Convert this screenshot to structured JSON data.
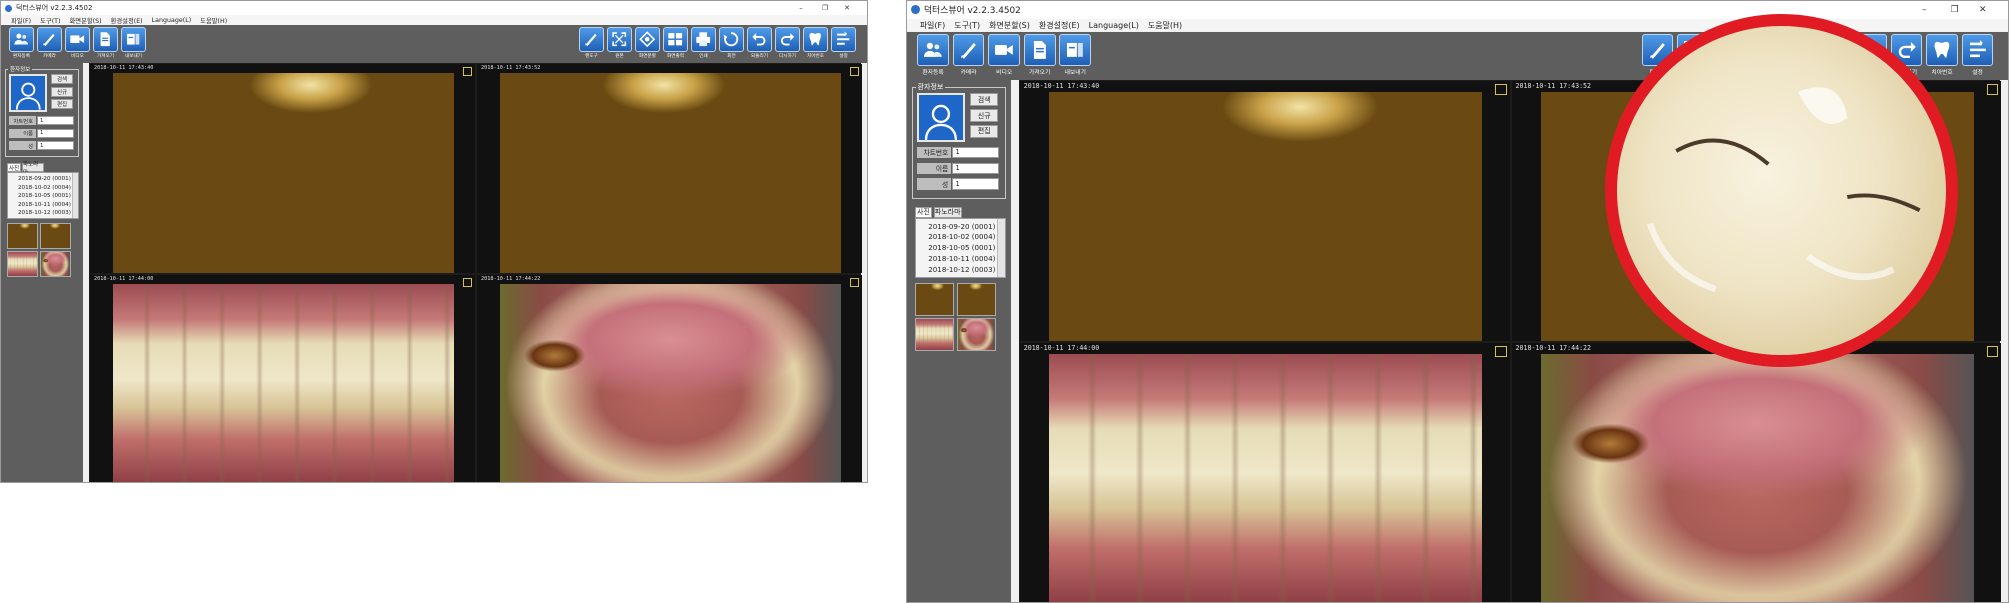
{
  "app": {
    "title": "덕터스뷰어 v2.2.3.4502",
    "menus": [
      "파일(F)",
      "도구(T)",
      "화면분할(S)",
      "환경설정(E)",
      "Language(L)",
      "도움말(H)"
    ]
  },
  "window_controls": {
    "minimize": "–",
    "maximize": "❐",
    "close": "✕"
  },
  "toolbar_left": [
    {
      "label": "환자등록",
      "icon": "patient-icon"
    },
    {
      "label": "카메라",
      "icon": "pen-icon"
    },
    {
      "label": "비디오",
      "icon": "video-icon"
    },
    {
      "label": "가져오기",
      "icon": "import-icon"
    },
    {
      "label": "내보내기",
      "icon": "export-icon"
    }
  ],
  "toolbar_right": [
    {
      "label": "펜도구",
      "icon": "pen-icon"
    },
    {
      "label": "원본",
      "icon": "fullscreen-icon"
    },
    {
      "label": "화면분할",
      "icon": "split-icon"
    },
    {
      "label": "화면출력",
      "icon": "grid-icon"
    },
    {
      "label": "인쇄",
      "icon": "print-icon"
    },
    {
      "label": "회전",
      "icon": "rotate-icon"
    },
    {
      "label": "되돌리기",
      "icon": "undo-icon"
    },
    {
      "label": "다시하기",
      "icon": "redo-icon"
    },
    {
      "label": "치아번호",
      "icon": "tooth-icon"
    },
    {
      "label": "설정",
      "icon": "settings-icon"
    }
  ],
  "patient": {
    "group_title": "환자정보",
    "buttons": {
      "search": "검색",
      "new": "신규",
      "edit": "편집"
    },
    "fields": [
      {
        "label": "차트번호",
        "value": "1"
      },
      {
        "label": "이름",
        "value": "1"
      },
      {
        "label": "성",
        "value": "1"
      }
    ]
  },
  "tabs": {
    "photos": "사진",
    "panorama": "파노라마"
  },
  "dates": [
    "2018-09-20 (0001)",
    "2018-10-02 (0004)",
    "2018-10-05 (0001)",
    "2018-10-11 (0004)",
    "2018-10-12 (0003)"
  ],
  "viewer_timestamps": [
    "2018-10-11 17:43:40",
    "2018-10-11 17:43:52",
    "2018-10-11 17:44:00",
    "2018-10-11 17:44:22"
  ],
  "colors": {
    "toolbar_bg": "#5e5e5e",
    "icon_blue": "#2a74d2",
    "viewer_bg": "#1c1c1c",
    "magnifier_ring": "#e01b24",
    "marker": "#d6c24a"
  }
}
